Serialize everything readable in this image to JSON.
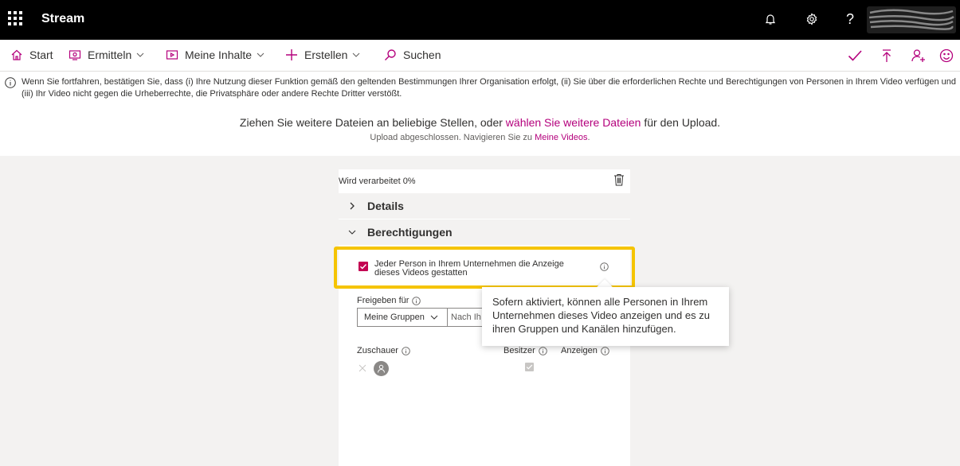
{
  "app": {
    "title": "Stream"
  },
  "header": {
    "icons": [
      "bell-icon",
      "gear-icon",
      "help-icon"
    ],
    "help_glyph": "?"
  },
  "nav": {
    "start": "Start",
    "ermitteln": "Ermitteln",
    "meine_inhalte": "Meine Inhalte",
    "erstellen": "Erstellen",
    "suchen": "Suchen"
  },
  "notice": {
    "text": "Wenn Sie fortfahren, bestätigen Sie, dass (i) Ihre Nutzung dieser Funktion gemäß den geltenden Bestimmungen Ihrer Organisation erfolgt, (ii) Sie über die erforderlichen Rechte und Berechtigungen von Personen in Ihrem Video verfügen und (iii) Ihr Video nicht gegen die Urheberrechte, die Privatsphäre oder andere Rechte Dritter verstößt."
  },
  "upload": {
    "drop_prefix": "Ziehen Sie weitere Dateien an beliebige Stellen, oder ",
    "drop_link": "wählen Sie weitere Dateien",
    "drop_suffix": " für den Upload.",
    "done_prefix": "Upload abgeschlossen. Navigieren Sie zu ",
    "done_link": "Meine Videos",
    "done_suffix": "."
  },
  "card": {
    "processing": "Wird verarbeitet 0%",
    "progress_percent": 0,
    "details": "Details",
    "permissions": "Berechtigungen",
    "allow_label": "Jeder Person in Ihrem Unternehmen die Anzeige dieses Videos gestatten",
    "allow_checked": true,
    "share_for": "Freigeben für",
    "group_select": "Meine Gruppen",
    "search_placeholder": "Nach Ih",
    "viewers": "Zuschauer",
    "owner": "Besitzer",
    "show": "Anzeigen"
  },
  "tooltip": {
    "text": "Sofern aktiviert, können alle Personen in Ihrem Unternehmen dieses Video anzeigen und es zu ihren Gruppen und Kanälen hinzufügen."
  },
  "colors": {
    "accent": "#b4007c",
    "checkbox": "#c30052",
    "highlight": "#f5c400",
    "topbar": "#000000"
  }
}
